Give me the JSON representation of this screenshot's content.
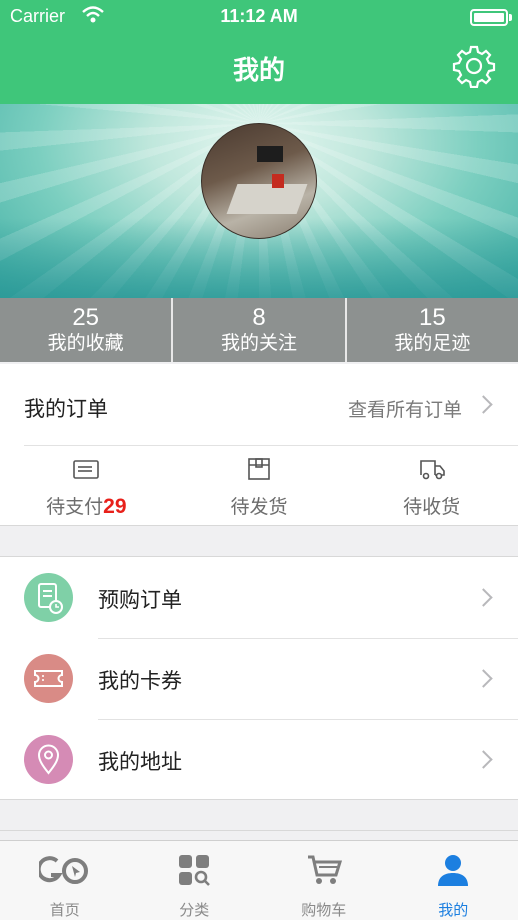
{
  "status_bar": {
    "carrier": "Carrier",
    "time": "11:12 AM"
  },
  "nav": {
    "title": "我的",
    "settings_icon": "gear-icon"
  },
  "profile": {
    "avatar": "avatar-photo"
  },
  "stats": [
    {
      "value": "25",
      "label": "我的收藏"
    },
    {
      "value": "8",
      "label": "我的关注"
    },
    {
      "value": "15",
      "label": "我的足迹"
    }
  ],
  "orders": {
    "title": "我的订单",
    "view_all": "查看所有订单",
    "states": [
      {
        "label": "待支付",
        "count": "29",
        "icon": "wallet-icon"
      },
      {
        "label": "待发货",
        "count": "",
        "icon": "package-icon"
      },
      {
        "label": "待收货",
        "count": "",
        "icon": "truck-icon"
      }
    ]
  },
  "menu": [
    {
      "label": "预购订单",
      "icon": "preorder-icon",
      "color": "#7fd0a7"
    },
    {
      "label": "我的卡券",
      "icon": "coupon-icon",
      "color": "#d98b86"
    },
    {
      "label": "我的地址",
      "icon": "location-icon",
      "color": "#d58bb5"
    }
  ],
  "tabbar": {
    "active_color": "#1c7fe0",
    "items": [
      {
        "label": "首页",
        "icon": "home-logo-icon"
      },
      {
        "label": "分类",
        "icon": "category-icon"
      },
      {
        "label": "购物车",
        "icon": "cart-icon"
      },
      {
        "label": "我的",
        "icon": "user-icon"
      }
    ]
  },
  "colors": {
    "brand": "#3fc67a",
    "badge_red": "#e8201a"
  }
}
